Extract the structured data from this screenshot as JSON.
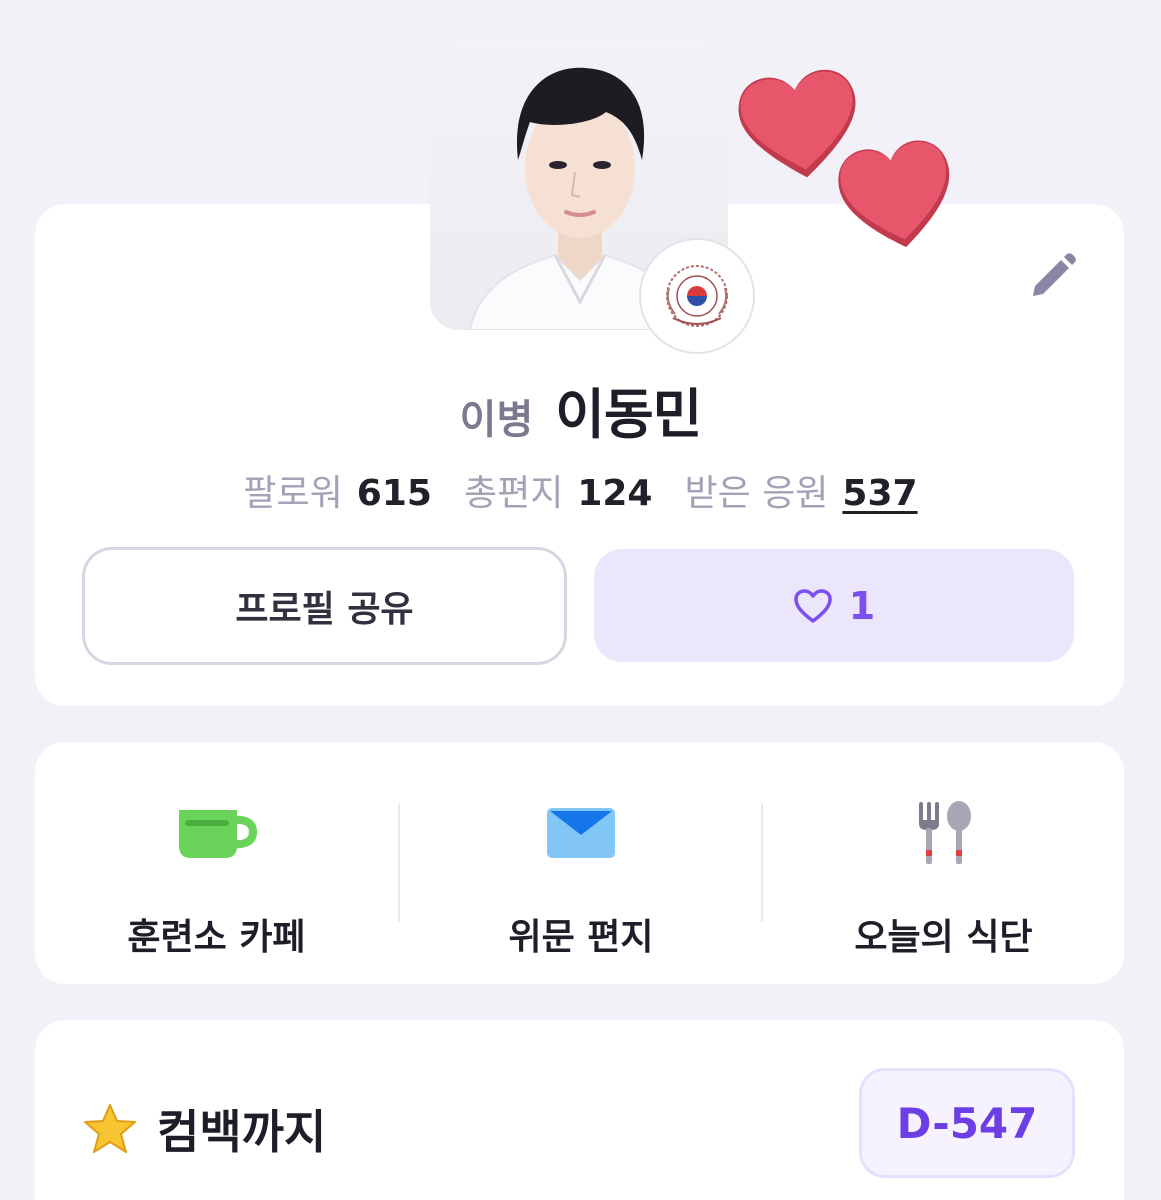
{
  "profile": {
    "rank": "이병",
    "name": "이동민",
    "photo_alt": "profile-photo",
    "stats": [
      {
        "label": "팔로워",
        "value": "615"
      },
      {
        "label": "총편지",
        "value": "124"
      },
      {
        "label": "받은 응원",
        "value": "537"
      }
    ],
    "share_label": "프로필 공유",
    "like_count": "1"
  },
  "menu": [
    {
      "label": "훈련소 카페",
      "icon": "coffee-cup-icon"
    },
    {
      "label": "위문 편지",
      "icon": "envelope-icon"
    },
    {
      "label": "오늘의 식단",
      "icon": "fork-spoon-icon"
    }
  ],
  "comeback": {
    "title": "컴백까지",
    "icon": "star-icon",
    "dday": "D-547"
  },
  "colors": {
    "background": "#f2f1f8",
    "card": "#ffffff",
    "accent_purple": "#6b3fe5",
    "like_bg": "#ece6fd",
    "heart_red": "#e8566b",
    "cup_green": "#6ad35a",
    "envelope_blue": "#82c6f7"
  }
}
